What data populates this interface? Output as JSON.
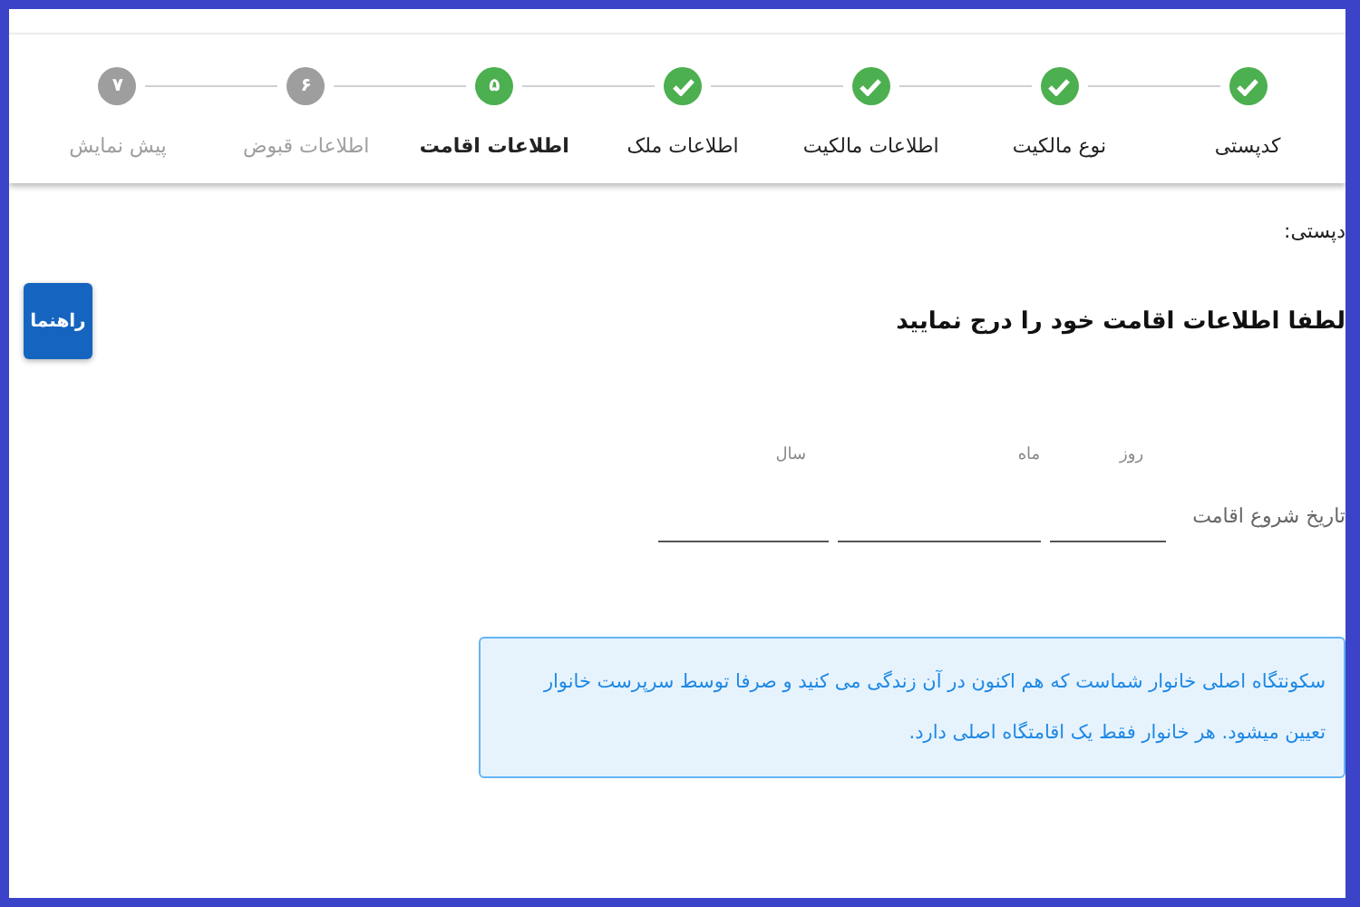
{
  "steps": [
    {
      "label": "کدپستی",
      "kind": "done"
    },
    {
      "label": "نوع مالکیت",
      "kind": "done"
    },
    {
      "label": "اطلاعات مالکیت",
      "kind": "done"
    },
    {
      "label": "اطلاعات ملک",
      "kind": "done"
    },
    {
      "label": "اطلاعات اقامت",
      "kind": "current",
      "number": "۵"
    },
    {
      "label": "اطلاعات قبوض",
      "kind": "pending",
      "number": "۶"
    },
    {
      "label": "پیش نمایش",
      "kind": "pending",
      "number": "۷"
    }
  ],
  "postal_code_label": "دپستی:",
  "heading": "لطفا اطلاعات اقامت خود را درج نمایید",
  "help_button": "راهنما",
  "date_field": {
    "label": "تاریخ شروع اقامت",
    "parts": [
      {
        "label": "روز"
      },
      {
        "label": "ماه"
      },
      {
        "label": "سال"
      }
    ]
  },
  "info": "سکونتگاه اصلی خانوار شماست که هم اکنون در آن زندگی می کنید و صرفا توسط سرپرست خانوار تعیین میشود. هر خانوار فقط یک اقامتگاه اصلی دارد."
}
